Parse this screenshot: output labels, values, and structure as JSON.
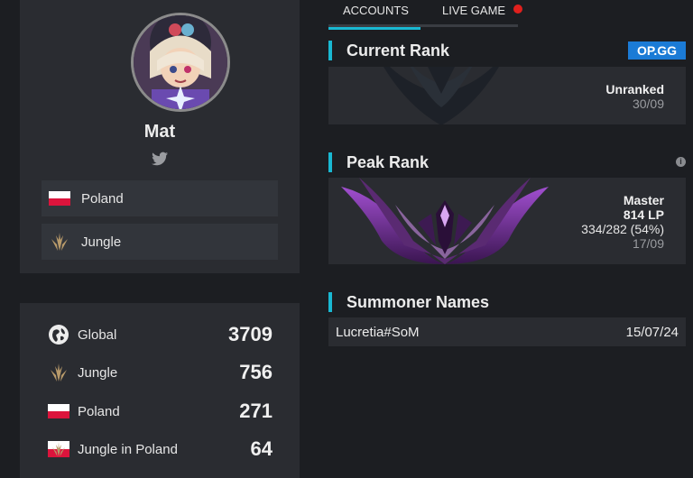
{
  "profile": {
    "name": "Mat",
    "country": "Poland",
    "role": "Jungle"
  },
  "stats": [
    {
      "label": "Global",
      "value": "3709",
      "icon": "globe-icon"
    },
    {
      "label": "Jungle",
      "value": "756",
      "icon": "jungle-icon"
    },
    {
      "label": "Poland",
      "value": "271",
      "icon": "poland-flag-icon"
    },
    {
      "label": "Jungle in Poland",
      "value": "64",
      "icon": "jungle-poland-icon"
    }
  ],
  "tabs": {
    "accounts": "ACCOUNTS",
    "live_game": "LIVE GAME"
  },
  "current_rank": {
    "title": "Current Rank",
    "badge": "OP.GG",
    "tier": "Unranked",
    "date": "30/09"
  },
  "peak_rank": {
    "title": "Peak Rank",
    "info": "i",
    "tier": "Master",
    "lp": "814 LP",
    "record": "334/282 (54%)",
    "date": "17/09"
  },
  "summoner_names": {
    "title": "Summoner Names",
    "entries": [
      {
        "name": "Lucretia#SoM",
        "date": "15/07/24"
      }
    ]
  },
  "colors": {
    "accent": "#19b8d2",
    "opgg": "#1b7bd6",
    "live": "#e0201d",
    "card": "#2a2c31",
    "background": "#1c1e22"
  }
}
